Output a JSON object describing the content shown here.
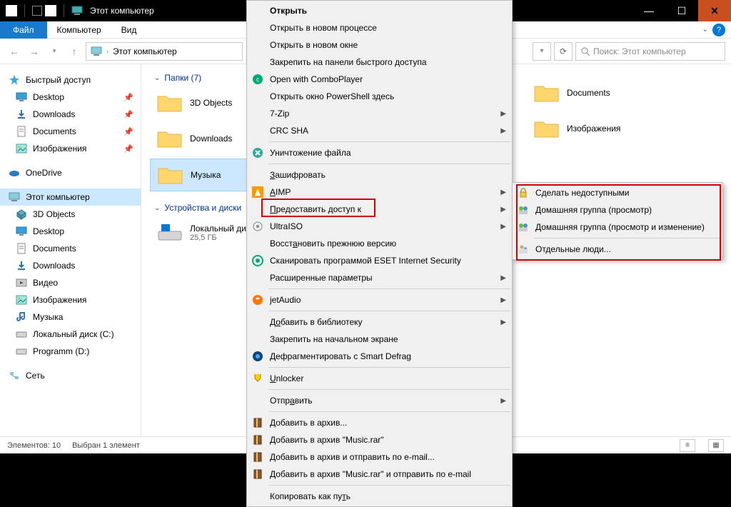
{
  "titlebar": {
    "title": "Этот компьютер"
  },
  "ribbon": {
    "file": "Файл",
    "computer": "Компьютер",
    "view": "Вид"
  },
  "address": {
    "location": "Этот компьютер",
    "search_placeholder": "Поиск: Этот компьютер"
  },
  "sidebar": {
    "quick": "Быстрый доступ",
    "quick_items": [
      "Desktop",
      "Downloads",
      "Documents",
      "Изображения"
    ],
    "onedrive": "OneDrive",
    "thispc": "Этот компьютер",
    "pc_items": [
      "3D Objects",
      "Desktop",
      "Documents",
      "Downloads",
      "Видео",
      "Изображения",
      "Музыка",
      "Локальный диск (C:)",
      "Programm (D:)"
    ],
    "network": "Сеть"
  },
  "content": {
    "folders_header": "Папки (7)",
    "devices_header": "Устройства и диски",
    "left_items": [
      {
        "label": "3D Objects"
      },
      {
        "label": "Downloads"
      },
      {
        "label": "Музыка",
        "selected": true
      }
    ],
    "right_items": [
      {
        "label": "Documents"
      },
      {
        "label": "Изображения"
      }
    ],
    "disk": {
      "label": "Локальный диск",
      "sub": "25,5 ГБ"
    }
  },
  "statusbar": {
    "elements": "Элементов: 10",
    "selected": "Выбран 1 элемент"
  },
  "ctx": {
    "items": [
      {
        "text": "Открыть",
        "bold": true
      },
      {
        "text": "Открыть в новом процессе"
      },
      {
        "text": "Открыть в новом окне"
      },
      {
        "text": "Закрепить на панели быстрого доступа"
      },
      {
        "text": "Open with ComboPlayer",
        "icon": "combo"
      },
      {
        "text": "Открыть окно PowerShell здесь"
      },
      {
        "text": "7-Zip",
        "arrow": true
      },
      {
        "text": "CRC SHA",
        "arrow": true
      },
      {
        "sep": true
      },
      {
        "text": "Уничтожение файла",
        "icon": "destroy"
      },
      {
        "sep": true
      },
      {
        "text": "Зашифровать",
        "underline": 0
      },
      {
        "text": "AIMP",
        "underline": 0,
        "icon": "aimp",
        "arrow": true
      },
      {
        "text": "Предоставить доступ к",
        "underline": 0,
        "arrow": true,
        "highlight": true
      },
      {
        "text": "UltraISO",
        "icon": "uiso",
        "arrow": true
      },
      {
        "text": "Восстановить прежнюю версию",
        "underline": 5
      },
      {
        "text": "Сканировать программой ESET Internet Security",
        "icon": "eset"
      },
      {
        "text": "Расширенные параметры",
        "arrow": true
      },
      {
        "sep": true
      },
      {
        "text": "jetAudio",
        "icon": "jet",
        "arrow": true
      },
      {
        "sep": true
      },
      {
        "text": "Добавить в библиотеку",
        "underline": 1,
        "arrow": true
      },
      {
        "text": "Закрепить на начальном экране"
      },
      {
        "text": "Дефрагментировать с Smart Defrag",
        "icon": "defrag"
      },
      {
        "sep": true
      },
      {
        "text": "Unlocker",
        "underline": 0,
        "icon": "unlock"
      },
      {
        "sep": true
      },
      {
        "text": "Отправить",
        "underline": 4,
        "arrow": true
      },
      {
        "sep": true
      },
      {
        "text": "Добавить в архив...",
        "icon": "rar"
      },
      {
        "text": "Добавить в архив \"Music.rar\"",
        "icon": "rar"
      },
      {
        "text": "Добавить в архив и отправить по e-mail...",
        "icon": "rar"
      },
      {
        "text": "Добавить в архив \"Music.rar\" и отправить по e-mail",
        "icon": "rar"
      },
      {
        "sep": true
      },
      {
        "text": "Копировать как путь",
        "underline": 17
      }
    ]
  },
  "submenu": {
    "items": [
      {
        "text": "Сделать недоступными",
        "icon": "lock"
      },
      {
        "text": "Домашняя группа (просмотр)",
        "icon": "hgv"
      },
      {
        "text": "Домашняя группа (просмотр и изменение)",
        "icon": "hge"
      },
      {
        "sep": true
      },
      {
        "text": "Отдельные люди...",
        "icon": "people"
      }
    ]
  }
}
